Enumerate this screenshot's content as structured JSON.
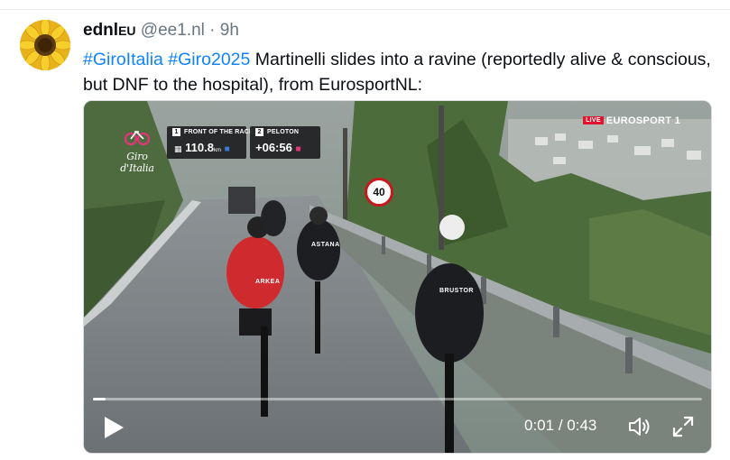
{
  "post": {
    "display_name": "ednl",
    "display_suffix": "EU",
    "handle": "@ee1.nl",
    "separator": " · ",
    "timestamp": "9h",
    "hashtags": [
      "#GiroItalia",
      "#Giro2025"
    ],
    "body_text": " Martinelli slides into a ravine (reportedly alive & conscious, but DNF to the hospital), from EurosportNL:"
  },
  "video": {
    "overlay": {
      "race_logo": "Giro d'Italia",
      "front_of_race": {
        "number": "1",
        "label": "FRONT OF THE RACE",
        "value": "110.8",
        "unit": "km"
      },
      "peloton": {
        "number": "2",
        "label": "PELOTON",
        "value": "+06:56"
      },
      "live_label": "LIVE",
      "broadcaster": "EUROSPORT 1",
      "speed_sign": "40",
      "jersey_arkea": "ARKEA",
      "jersey_brustor": "BRUSTOR",
      "jersey_astana": "ASTANA"
    },
    "current_time": "0:01",
    "time_separator": " / ",
    "duration": "0:43",
    "progress": 0.02,
    "accent_color": "#1083fe"
  }
}
